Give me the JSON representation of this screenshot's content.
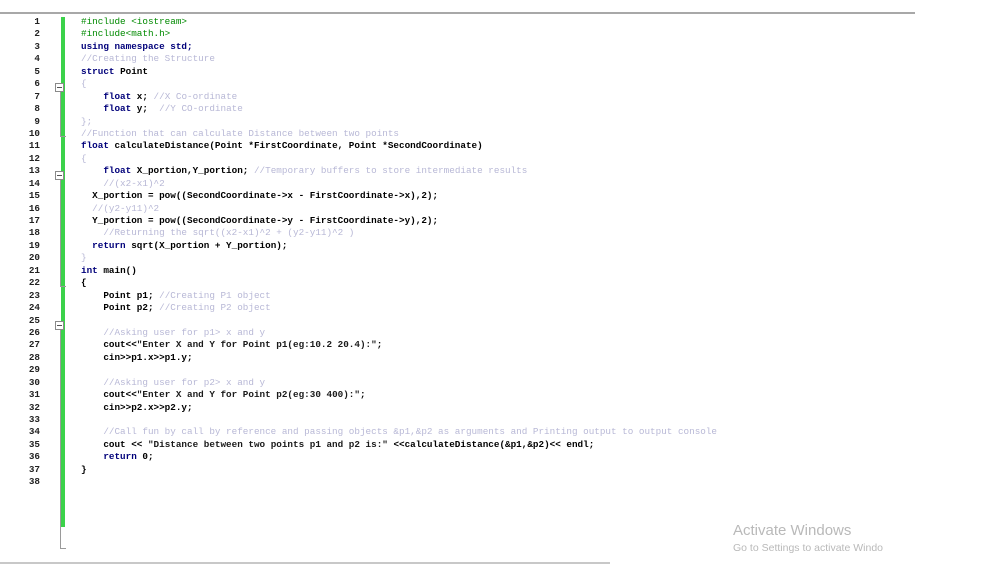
{
  "editor": {
    "lines": [
      {
        "n": "1",
        "segments": [
          {
            "t": "#include <iostream>",
            "cls": "pp"
          }
        ]
      },
      {
        "n": "2",
        "segments": [
          {
            "t": "#include<math.h>",
            "cls": "pp"
          }
        ]
      },
      {
        "n": "3",
        "segments": [
          {
            "t": "using namespace std;",
            "cls": "k"
          }
        ]
      },
      {
        "n": "4",
        "segments": [
          {
            "t": "//Creating the Structure",
            "cls": "c"
          }
        ]
      },
      {
        "n": "5",
        "segments": [
          {
            "t": "struct ",
            "cls": "k"
          },
          {
            "t": "Point",
            "cls": "g"
          }
        ]
      },
      {
        "n": "6",
        "segments": [
          {
            "t": "{",
            "cls": "c"
          }
        ]
      },
      {
        "n": "7",
        "segments": [
          {
            "t": "    float ",
            "cls": "k"
          },
          {
            "t": "x; ",
            "cls": "g"
          },
          {
            "t": "//X Co-ordinate",
            "cls": "c"
          }
        ]
      },
      {
        "n": "8",
        "segments": [
          {
            "t": "    float ",
            "cls": "k"
          },
          {
            "t": "y;  ",
            "cls": "g"
          },
          {
            "t": "//Y CO-ordinate",
            "cls": "c"
          }
        ]
      },
      {
        "n": "9",
        "segments": [
          {
            "t": "};",
            "cls": "c"
          }
        ]
      },
      {
        "n": "10",
        "segments": [
          {
            "t": "//Function that can calculate Distance between two points",
            "cls": "c"
          }
        ]
      },
      {
        "n": "11",
        "segments": [
          {
            "t": "float ",
            "cls": "k"
          },
          {
            "t": "calculateDistance(Point *FirstCoordinate, Point *SecondCoordinate)",
            "cls": "g"
          }
        ]
      },
      {
        "n": "12",
        "segments": [
          {
            "t": "{",
            "cls": "c"
          }
        ]
      },
      {
        "n": "13",
        "segments": [
          {
            "t": "    float ",
            "cls": "k"
          },
          {
            "t": "X_portion,Y_portion; ",
            "cls": "g"
          },
          {
            "t": "//Temporary buffers to store intermediate results",
            "cls": "c"
          }
        ]
      },
      {
        "n": "14",
        "segments": [
          {
            "t": "    //(x2-x1)^2",
            "cls": "c"
          }
        ]
      },
      {
        "n": "15",
        "segments": [
          {
            "t": "  X_portion = pow((SecondCoordinate->x - FirstCoordinate->x),2);",
            "cls": "g"
          }
        ]
      },
      {
        "n": "16",
        "segments": [
          {
            "t": "  //(y2-y11)^2",
            "cls": "c"
          }
        ]
      },
      {
        "n": "17",
        "segments": [
          {
            "t": "  Y_portion = pow((SecondCoordinate->y - FirstCoordinate->y),2);",
            "cls": "g"
          }
        ]
      },
      {
        "n": "18",
        "segments": [
          {
            "t": "    //Returning the sqrt((x2-x1)^2 + (y2-y11)^2 )",
            "cls": "c"
          }
        ]
      },
      {
        "n": "19",
        "segments": [
          {
            "t": "  return ",
            "cls": "k"
          },
          {
            "t": "sqrt(X_portion + Y_portion);",
            "cls": "g"
          }
        ]
      },
      {
        "n": "20",
        "segments": [
          {
            "t": "}",
            "cls": "c"
          }
        ]
      },
      {
        "n": "21",
        "segments": [
          {
            "t": "int ",
            "cls": "k"
          },
          {
            "t": "main()",
            "cls": "g"
          }
        ]
      },
      {
        "n": "22",
        "segments": [
          {
            "t": "{",
            "cls": "g"
          }
        ]
      },
      {
        "n": "23",
        "segments": [
          {
            "t": "    Point p1; ",
            "cls": "g"
          },
          {
            "t": "//Creating P1 object",
            "cls": "c"
          }
        ]
      },
      {
        "n": "24",
        "segments": [
          {
            "t": "    Point p2; ",
            "cls": "g"
          },
          {
            "t": "//Creating P2 object",
            "cls": "c"
          }
        ]
      },
      {
        "n": "25",
        "segments": [
          {
            "t": "",
            "cls": "g"
          }
        ]
      },
      {
        "n": "26",
        "segments": [
          {
            "t": "    //Asking user for p1> x and y",
            "cls": "c"
          }
        ]
      },
      {
        "n": "27",
        "segments": [
          {
            "t": "    cout<<",
            "cls": "g"
          },
          {
            "t": "\"Enter X and Y for Point p1(eg:10.2 20.4):\"",
            "cls": "s"
          },
          {
            "t": ";",
            "cls": "g"
          }
        ]
      },
      {
        "n": "28",
        "segments": [
          {
            "t": "    cin>>p1.x>>p1.y;",
            "cls": "g"
          }
        ]
      },
      {
        "n": "29",
        "segments": [
          {
            "t": "",
            "cls": "g"
          }
        ]
      },
      {
        "n": "30",
        "segments": [
          {
            "t": "    //Asking user for p2> x and y",
            "cls": "c"
          }
        ]
      },
      {
        "n": "31",
        "segments": [
          {
            "t": "    cout<<",
            "cls": "g"
          },
          {
            "t": "\"Enter X and Y for Point p2(eg:30 400):\"",
            "cls": "s"
          },
          {
            "t": ";",
            "cls": "g"
          }
        ]
      },
      {
        "n": "32",
        "segments": [
          {
            "t": "    cin>>p2.x>>p2.y;",
            "cls": "g"
          }
        ]
      },
      {
        "n": "33",
        "segments": [
          {
            "t": "",
            "cls": "g"
          }
        ]
      },
      {
        "n": "34",
        "segments": [
          {
            "t": "    //Call fun by call by reference and passing objects &p1,&p2 as arguments and Printing output to output console",
            "cls": "c"
          }
        ]
      },
      {
        "n": "35",
        "segments": [
          {
            "t": "    cout << ",
            "cls": "g"
          },
          {
            "t": "\"Distance between two points p1 and p2 is:\"",
            "cls": "s"
          },
          {
            "t": " <<calculateDistance(&p1,&p2)<< endl;",
            "cls": "g"
          }
        ]
      },
      {
        "n": "36",
        "segments": [
          {
            "t": "    return ",
            "cls": "k"
          },
          {
            "t": "0;",
            "cls": "g"
          }
        ]
      },
      {
        "n": "37",
        "segments": [
          {
            "t": "}",
            "cls": "g"
          }
        ]
      },
      {
        "n": "38",
        "segments": [
          {
            "t": "",
            "cls": "g"
          }
        ]
      }
    ]
  },
  "watermark": {
    "title": "Activate Windows",
    "subtitle": "Go to Settings to activate Windo"
  }
}
